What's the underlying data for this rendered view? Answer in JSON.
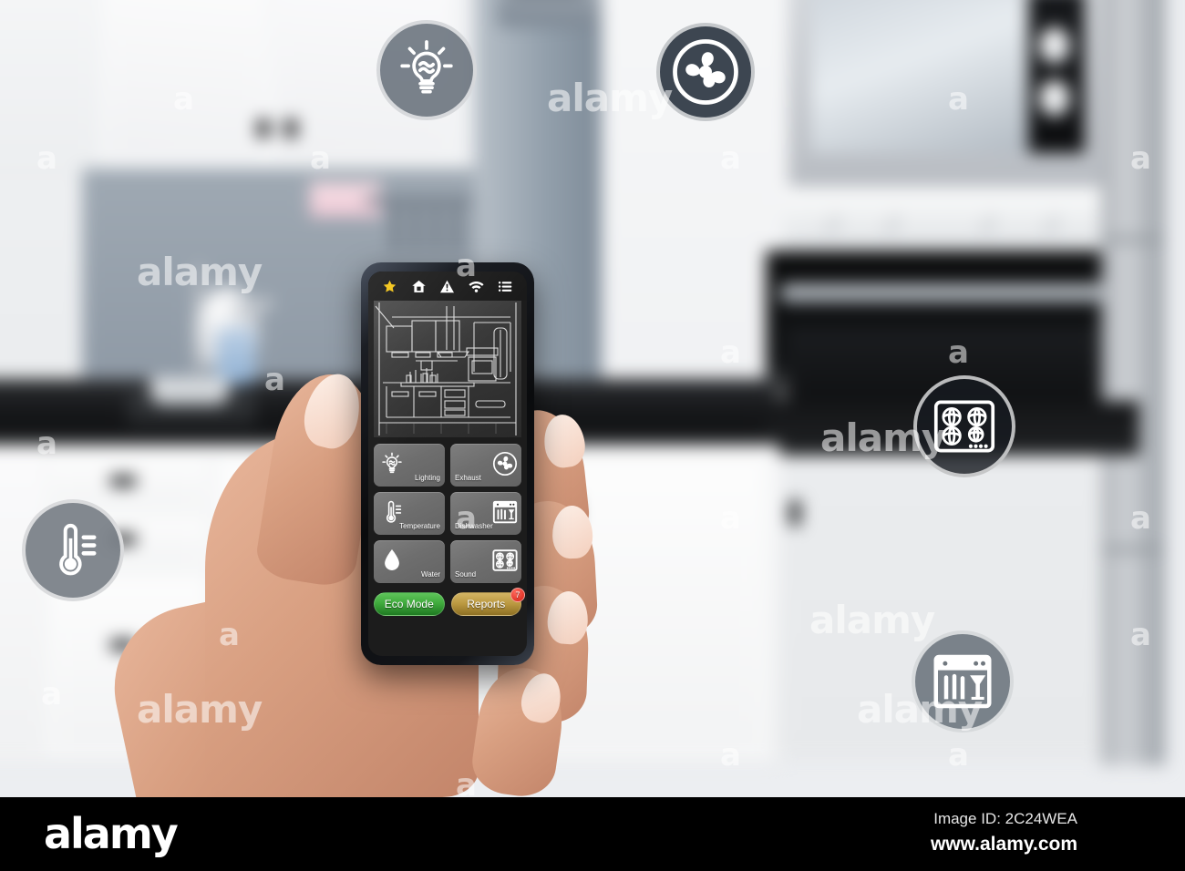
{
  "scene": {
    "description": "Hand holding smartphone with smart-home kitchen control app in front of a blurred modern kitchen",
    "background_label": "blurred-kitchen"
  },
  "app": {
    "topbar": [
      {
        "name": "favorites-icon",
        "glyph": "star",
        "color": "#f2c314"
      },
      {
        "name": "home-icon",
        "glyph": "house",
        "color": "#ffffff"
      },
      {
        "name": "alerts-icon",
        "glyph": "warning-triangle",
        "color": "#ffffff"
      },
      {
        "name": "wifi-icon",
        "glyph": "wifi",
        "color": "#ffffff"
      },
      {
        "name": "menu-icon",
        "glyph": "hamburger",
        "color": "#ffffff"
      }
    ],
    "hero": {
      "name": "kitchen-blueprint",
      "alt": "kitchen line drawing"
    },
    "tiles": [
      {
        "label": "Lighting",
        "icon": "lightbulb-icon",
        "side": "left"
      },
      {
        "label": "Exhaust",
        "icon": "fan-icon",
        "side": "right"
      },
      {
        "label": "Temperature",
        "icon": "thermometer-icon",
        "side": "left"
      },
      {
        "label": "Dishwasher",
        "icon": "dishwasher-icon",
        "side": "right"
      },
      {
        "label": "Water",
        "icon": "water-drop-icon",
        "side": "left"
      },
      {
        "label": "Sound",
        "icon": "cooktop-icon",
        "side": "right"
      }
    ],
    "actions": [
      {
        "label": "Eco Mode",
        "style": "eco",
        "color": "#3faa3c",
        "badge": null
      },
      {
        "label": "Reports",
        "style": "reports",
        "color": "#bb9941",
        "badge": "7"
      }
    ]
  },
  "floating_icons": [
    {
      "name": "lightbulb-icon",
      "label": "Lighting",
      "style": "gray"
    },
    {
      "name": "fan-icon",
      "label": "Exhaust fan",
      "style": "dark"
    },
    {
      "name": "cooktop-icon",
      "label": "Cooktop",
      "style": "dark"
    },
    {
      "name": "dishwasher-icon",
      "label": "Dishwasher",
      "style": "gray"
    },
    {
      "name": "thermometer-icon",
      "label": "Temperature",
      "style": "gray"
    }
  ],
  "watermark": {
    "letter": "a",
    "word": "alamy"
  },
  "footer": {
    "logo": "alamy",
    "image_id": "Image ID: 2C24WEA",
    "site": "www.alamy.com"
  },
  "colors": {
    "eco_green": "#3faa3c",
    "reports_gold": "#bb9941",
    "badge_red": "#d51d12",
    "star_yellow": "#f2c314",
    "icon_gray": "#6f7781",
    "icon_dark": "#2d3642"
  }
}
